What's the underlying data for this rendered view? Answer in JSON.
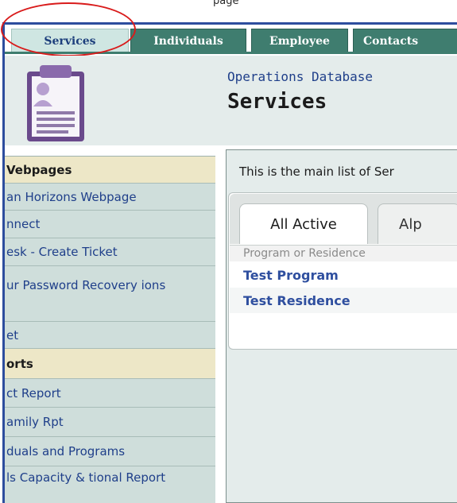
{
  "top_strip": {
    "cut_text": "page"
  },
  "tabs": [
    {
      "label": "Services",
      "active": true
    },
    {
      "label": "Individuals",
      "active": false
    },
    {
      "label": "Employee",
      "active": false
    },
    {
      "label": "Contacts",
      "active": false
    }
  ],
  "header": {
    "db_title": "Operations Database",
    "page_title": "Services",
    "icon": "clipboard-person-icon"
  },
  "sidebar": {
    "sections": [
      {
        "heading": "Vebpages"
      },
      {
        "heading": "orts"
      }
    ],
    "webpage_items": [
      "an Horizons Webpage",
      "nnect",
      "esk - Create Ticket",
      "ur Password Recovery ions",
      "et"
    ],
    "report_items": [
      "ct Report",
      "amily Rpt",
      "duals and Programs",
      "ls Capacity & tional Report"
    ]
  },
  "main": {
    "intro": "This is the main list of Ser",
    "tabs": [
      {
        "label": "All Active",
        "active": true
      },
      {
        "label": "Alp",
        "active": false
      }
    ],
    "column_header": "Program or Residence",
    "rows": [
      "Test Program",
      "Test Residence"
    ]
  },
  "colors": {
    "tab_green": "#3f7d6f",
    "active_tab": "#cfe6e2",
    "link_blue": "#2f4f9f",
    "highlight_red": "#d91b1b",
    "border_blue": "#2d4d9e"
  }
}
